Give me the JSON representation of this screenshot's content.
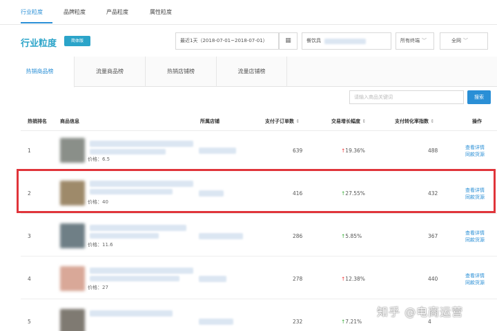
{
  "nav": {
    "tabs": [
      "行业粒度",
      "品牌粒度",
      "产品粒度",
      "属性粒度"
    ],
    "active": 0
  },
  "page": {
    "title": "行业粒度",
    "badge": "简体版"
  },
  "filters": {
    "date_range": "最近1天（2018-07-01~2018-07-01）",
    "category": "餐饮具",
    "terminal": "所有终端",
    "region": "全网"
  },
  "sub_tabs": [
    "热销商品榜",
    "流量商品榜",
    "热销店铺榜",
    "流量店铺榜"
  ],
  "search": {
    "placeholder": "请输入商品关键词",
    "button": "搜索"
  },
  "table": {
    "headers": {
      "rank": "热销排名",
      "product": "商品信息",
      "shop": "所属店铺",
      "orders": "支付子订单数",
      "growth": "交易增长幅度",
      "conversion": "支付转化率指数",
      "actions": "操作"
    },
    "sort_icon": "⇕",
    "rows": [
      {
        "rank": "1",
        "price": "价格：6.5",
        "orders": "639",
        "growth": "19.36%",
        "trend": "up-red",
        "conversion": "488",
        "thumb_color": "#8a8f89"
      },
      {
        "rank": "2",
        "price": "价格：40",
        "orders": "416",
        "growth": "27.55%",
        "trend": "up-green",
        "conversion": "432",
        "thumb_color": "#9e8a6a"
      },
      {
        "rank": "3",
        "price": "价格：11.6",
        "orders": "286",
        "growth": "5.85%",
        "trend": "up-green",
        "conversion": "367",
        "thumb_color": "#6f7f86"
      },
      {
        "rank": "4",
        "price": "价格：27",
        "orders": "278",
        "growth": "12.38%",
        "trend": "up-red",
        "conversion": "440",
        "thumb_color": "#d9a898"
      },
      {
        "rank": "5",
        "price": "",
        "orders": "232",
        "growth": "7.21%",
        "trend": "up-green",
        "conversion": "4",
        "thumb_color": "#7f7a72"
      }
    ],
    "action_detail": "查看详情",
    "action_similar": "同款货源"
  },
  "watermark": "知乎 @电商运营",
  "colors": {
    "accent": "#2a8fd6",
    "title": "#2ba4c9",
    "highlight": "#e0343a",
    "trend_red": "#e33333",
    "trend_green": "#33aa33"
  },
  "icons": {
    "calendar": "calendar-icon",
    "chevron": "chevron-down-icon",
    "arrow_up": "arrow-up-icon"
  }
}
